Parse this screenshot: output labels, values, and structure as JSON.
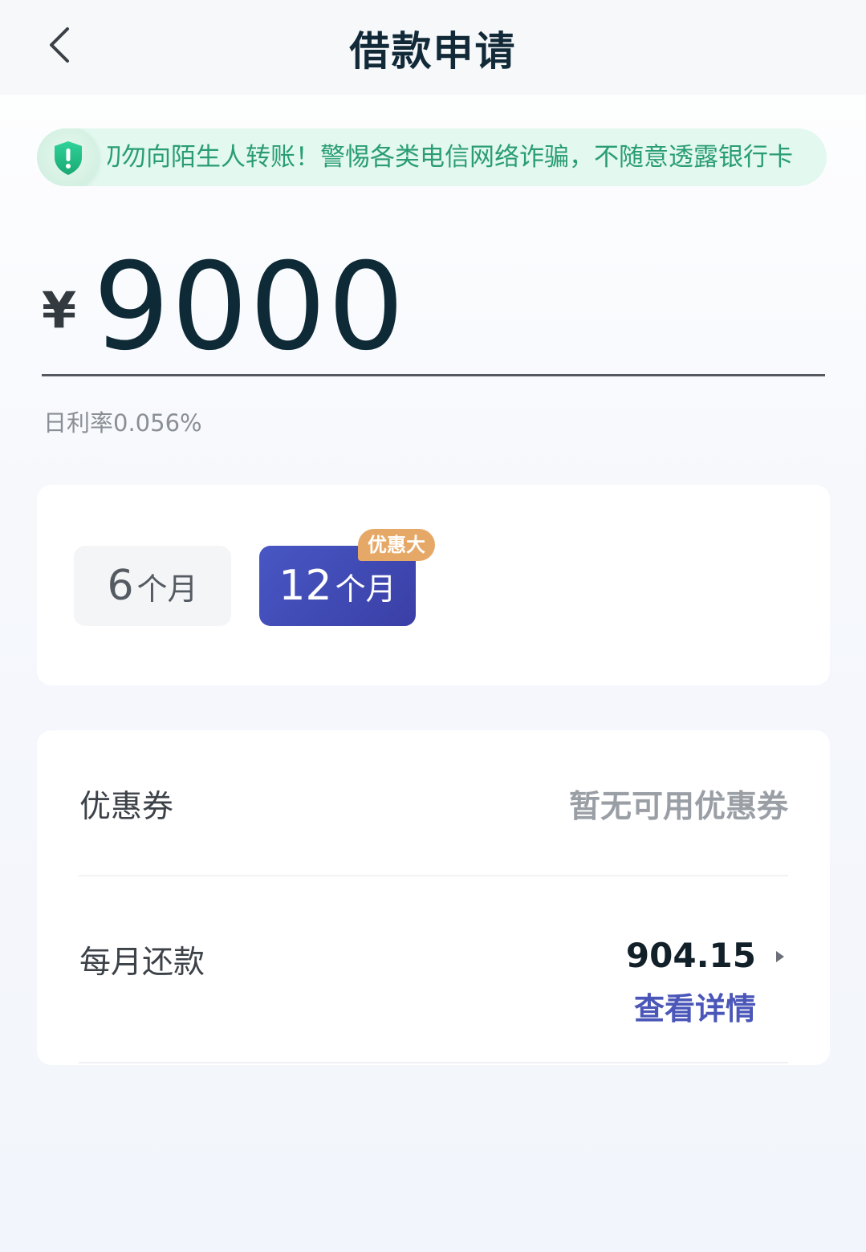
{
  "header": {
    "title": "借款申请",
    "back_icon": "chevron-left-icon"
  },
  "notice": {
    "icon": "shield-exclamation-icon",
    "text": "切勿向陌生人转账！警惕各类电信网络诈骗，不随意透露银行卡"
  },
  "amount": {
    "currency": "¥",
    "value": "9000"
  },
  "rate": {
    "text": "日利率0.056%"
  },
  "term": {
    "options": [
      {
        "num": "6",
        "unit": "个月",
        "selected": false
      },
      {
        "num": "12",
        "unit": "个月",
        "selected": true
      }
    ],
    "badge": "优惠大"
  },
  "coupon": {
    "label": "优惠券",
    "value": "暂无可用优惠券"
  },
  "repay": {
    "label": "每月还款",
    "amount": "904.15",
    "detail": "查看详情",
    "arrow_icon": "caret-right-icon"
  },
  "colors": {
    "accent": "#3f47b3",
    "badge": "#e6a867",
    "notice_text": "#2a9d74",
    "notice_bg": "#e3f8ef"
  }
}
